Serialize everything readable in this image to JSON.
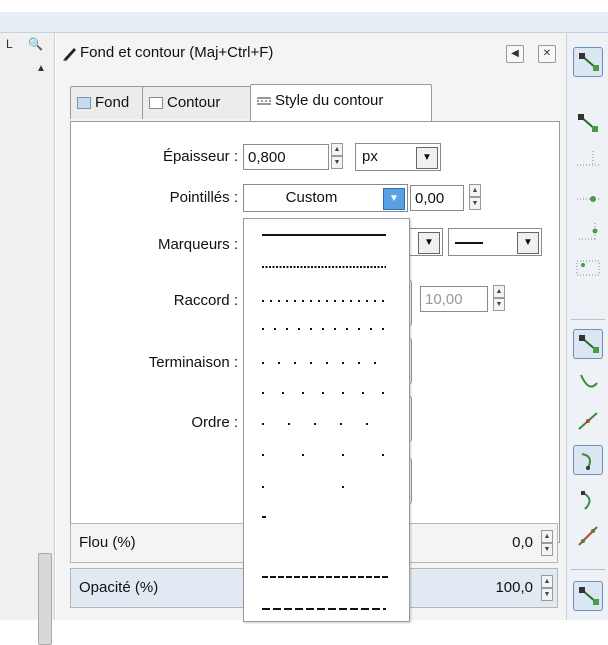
{
  "dialog": {
    "title": "Fond et contour (Maj+Ctrl+F)"
  },
  "left_ruler": {
    "mark": "L"
  },
  "tabs": [
    {
      "label": "Fond"
    },
    {
      "label": "Contour"
    },
    {
      "label": "Style du contour"
    }
  ],
  "stroke_style": {
    "width_label": "Épaisseur :",
    "width_value": "0,800",
    "unit": "px",
    "dash_label": "Pointillés :",
    "dash_value": "Custom",
    "dash_offset": "0,00",
    "markers_label": "Marqueurs :",
    "join_label": "Raccord :",
    "miter_value": "10,00",
    "cap_label": "Terminaison :",
    "order_label": "Ordre :"
  },
  "dash_options": [
    "solid",
    "dotted-fine",
    "dotted-1",
    "dotted-2",
    "dotted-3",
    "dotted-4",
    "dotted-5",
    "dotted-6",
    "dotted-7",
    "dotted-8",
    "dashed-fine",
    "dashed"
  ],
  "blur": {
    "label": "Flou (%)",
    "value": "0,0"
  },
  "opacity": {
    "label": "Opacité (%)",
    "value": "100,0"
  },
  "colors": {
    "accent": "#5aa0e6",
    "selection": "#dbe6f3",
    "panel": "#f4f4f4"
  },
  "right_toolbar": [
    "node-select-icon",
    "node-icon",
    "node-dotted-icon",
    "node-snap-icon",
    "node-center-icon",
    "node-select-2-icon",
    "curve-icon",
    "line-icon",
    "curve-selected-icon",
    "curve-2-icon",
    "diagonal-icon",
    "node-select-3-icon"
  ]
}
